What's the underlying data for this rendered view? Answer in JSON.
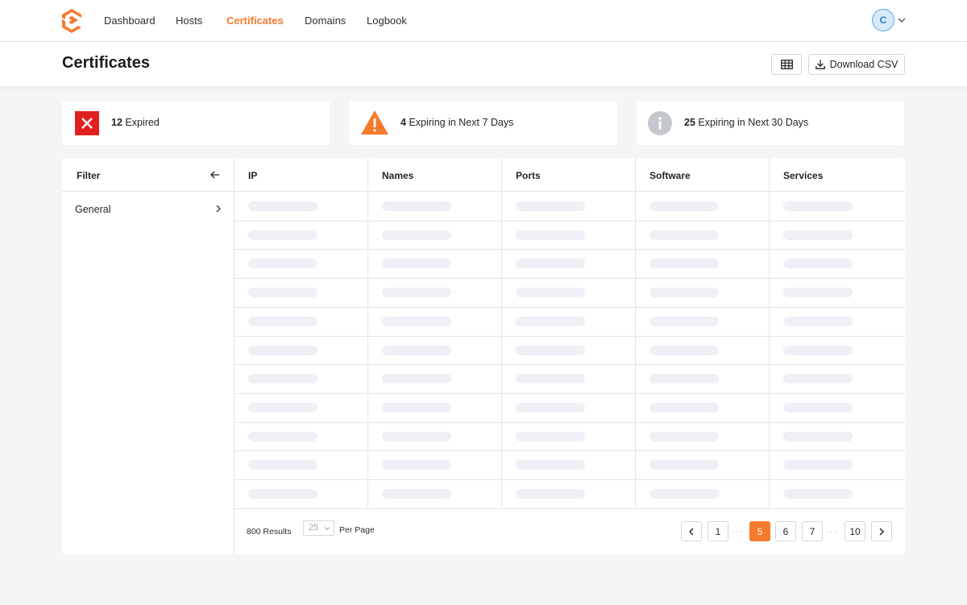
{
  "nav": {
    "items": [
      {
        "label": "Dashboard"
      },
      {
        "label": "Hosts"
      },
      {
        "label": "Certificates",
        "active": true
      },
      {
        "label": "Domains"
      },
      {
        "label": "Logbook"
      }
    ],
    "avatar_initial": "C",
    "logo_icon": "logo-icon",
    "accent_color": "#f57a2c"
  },
  "header": {
    "title": "Certificates",
    "grid_button_icon": "table-grid-icon",
    "download_label": "Download CSV",
    "download_icon": "download-icon"
  },
  "stats": [
    {
      "count": "12",
      "label": "Expired",
      "icon": "x-icon",
      "color": "#e02020"
    },
    {
      "count": "4",
      "label": "Expiring in Next 7 Days",
      "icon": "warning-icon",
      "color": "#f57a2c"
    },
    {
      "count": "25",
      "label": "Expiring in Next 30 Days",
      "icon": "info-icon",
      "color": "#c4c7cc"
    }
  ],
  "filter": {
    "title": "Filter",
    "back_icon": "arrow-left-icon",
    "items": [
      {
        "label": "General"
      }
    ]
  },
  "table": {
    "columns": [
      "IP",
      "Names",
      "Ports",
      "Software",
      "Services"
    ],
    "loading": true
  },
  "pagination": {
    "results": "800 Results",
    "per_page_value": "25",
    "per_page_label": "Per Page",
    "pages": [
      "1",
      "5",
      "6",
      "7",
      "10"
    ],
    "current": "5"
  }
}
